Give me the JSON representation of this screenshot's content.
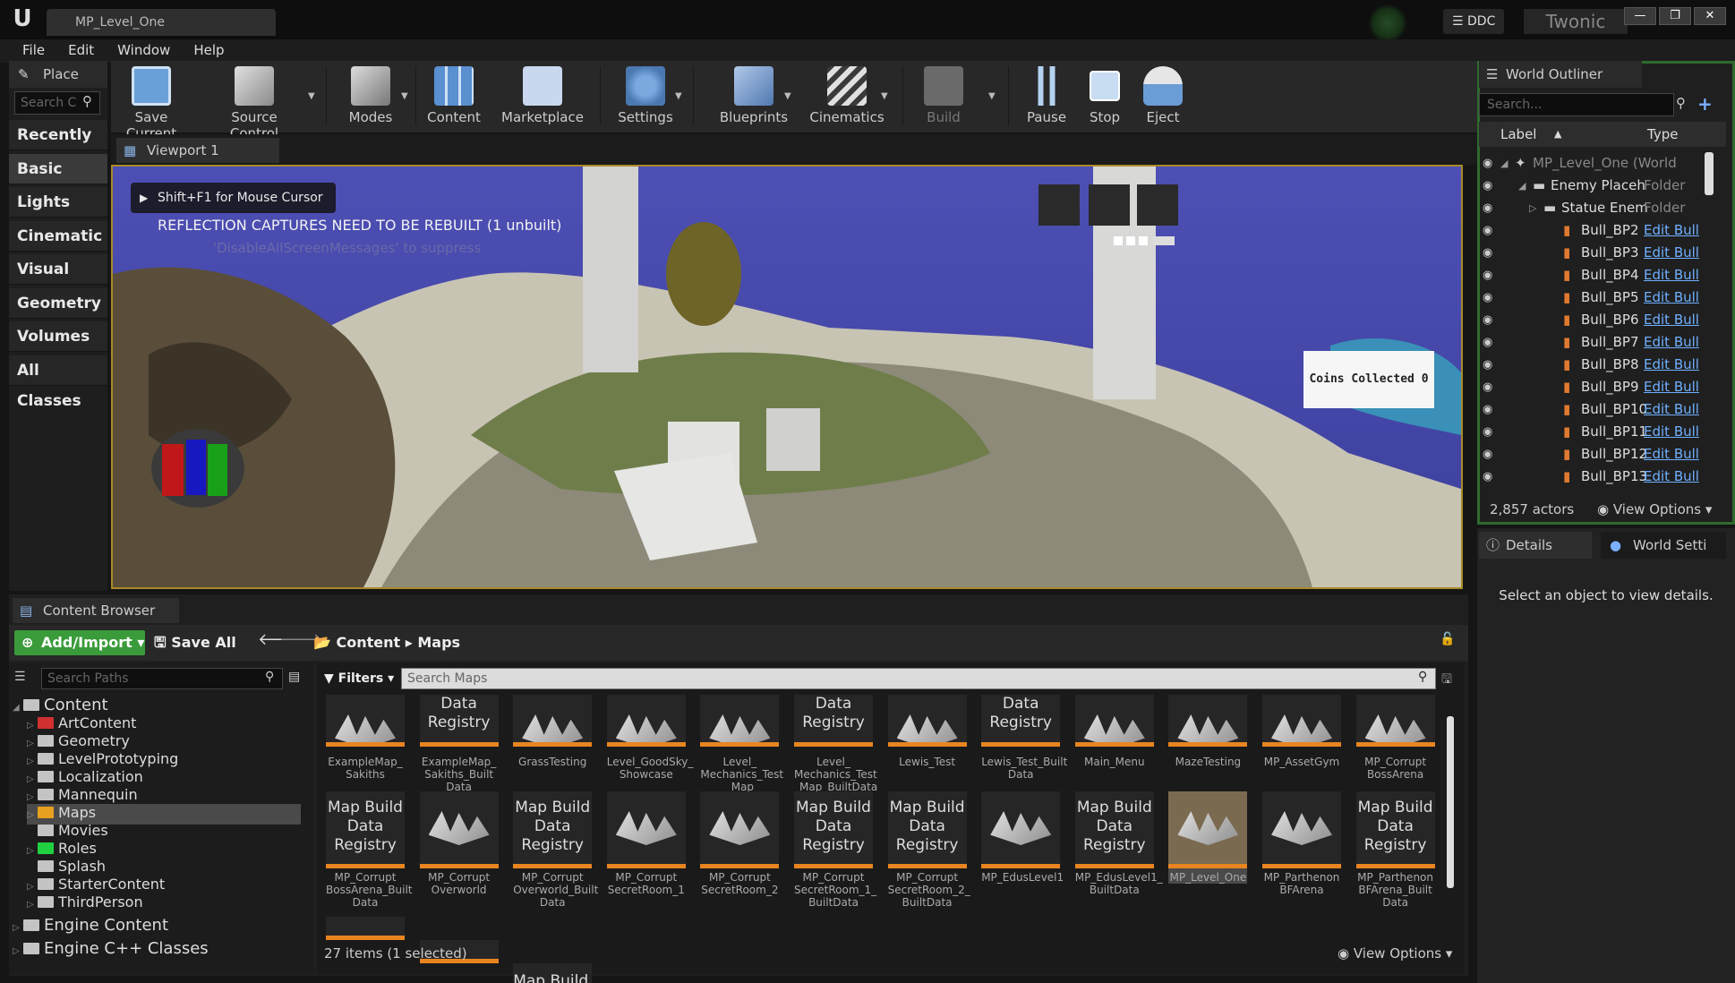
{
  "title_bar": {
    "tab": "MP_Level_One",
    "ddc": "DDC",
    "user": "Twonic"
  },
  "menu": [
    "File",
    "Edit",
    "Window",
    "Help"
  ],
  "place": {
    "tab": "Place",
    "search_placeholder": "Search C",
    "categories": [
      "Recently Pla",
      "Basic",
      "Lights",
      "Cinematic",
      "Visual Effect",
      "Geometry",
      "Volumes",
      "All Classes"
    ],
    "active": "Basic"
  },
  "toolbar": [
    "Save Current",
    "Source Control",
    "Modes",
    "Content",
    "Marketplace",
    "Settings",
    "Blueprints",
    "Cinematics",
    "Build",
    "Pause",
    "Stop",
    "Eject"
  ],
  "viewport": {
    "tab": "Viewport 1",
    "hint": "Shift+F1 for Mouse Cursor",
    "message": "REFLECTION CAPTURES NEED TO BE REBUILT (1 unbuilt)",
    "suppress": "'DisableAllScreenMessages' to suppress",
    "coins": "Coins Collected 0"
  },
  "world_outliner": {
    "tab": "World Outliner",
    "search_placeholder": "Search...",
    "col_label": "Label",
    "col_type": "Type",
    "rows": [
      {
        "label": "MP_Level_One (World",
        "type": "",
        "indent": 0
      },
      {
        "label": "Enemy Placeh",
        "type": "Folder",
        "indent": 1
      },
      {
        "label": "Statue Enem",
        "type": "Folder",
        "indent": 2
      },
      {
        "label": "Bull_BP2",
        "link": "Edit Bull",
        "indent": 3
      },
      {
        "label": "Bull_BP3",
        "link": "Edit Bull",
        "indent": 3
      },
      {
        "label": "Bull_BP4",
        "link": "Edit Bull",
        "indent": 3
      },
      {
        "label": "Bull_BP5",
        "link": "Edit Bull",
        "indent": 3
      },
      {
        "label": "Bull_BP6",
        "link": "Edit Bull",
        "indent": 3
      },
      {
        "label": "Bull_BP7",
        "link": "Edit Bull",
        "indent": 3
      },
      {
        "label": "Bull_BP8",
        "link": "Edit Bull",
        "indent": 3
      },
      {
        "label": "Bull_BP9",
        "link": "Edit Bull",
        "indent": 3
      },
      {
        "label": "Bull_BP10",
        "link": "Edit Bull",
        "indent": 3
      },
      {
        "label": "Bull_BP11",
        "link": "Edit Bull",
        "indent": 3
      },
      {
        "label": "Bull_BP12",
        "link": "Edit Bull",
        "indent": 3
      },
      {
        "label": "Bull_BP13",
        "link": "Edit Bull",
        "indent": 3
      }
    ],
    "actors": "2,857 actors",
    "view_options": "View Options"
  },
  "details": {
    "tab": "Details",
    "world_settings_tab": "World Setti",
    "message": "Select an object to view details."
  },
  "content_browser": {
    "tab": "Content Browser",
    "add_import": "Add/Import",
    "save_all": "Save All",
    "breadcrumb": [
      "Content",
      "Maps"
    ],
    "paths_placeholder": "Search Paths",
    "filters": "Filters",
    "search_placeholder": "Search Maps",
    "tree": [
      {
        "label": "Content",
        "level": 0,
        "big": true
      },
      {
        "label": "ArtContent",
        "level": 1,
        "color": "#d03030"
      },
      {
        "label": "Geometry",
        "level": 1
      },
      {
        "label": "LevelPrototyping",
        "level": 1
      },
      {
        "label": "Localization",
        "level": 1
      },
      {
        "label": "Mannequin",
        "level": 1
      },
      {
        "label": "Maps",
        "level": 1,
        "color": "#e8a020",
        "selected": true
      },
      {
        "label": "Movies",
        "level": 1
      },
      {
        "label": "Roles",
        "level": 1,
        "color": "#20d040"
      },
      {
        "label": "Splash",
        "level": 1
      },
      {
        "label": "StarterContent",
        "level": 1
      },
      {
        "label": "ThirdPerson",
        "level": 1
      },
      {
        "label": "Engine Content",
        "level": 0,
        "big": true
      },
      {
        "label": "Engine C++ Classes",
        "level": 0,
        "big": true
      }
    ],
    "row1": [
      {
        "name": "ExampleMap_\nSakiths",
        "kind": "map"
      },
      {
        "name": "ExampleMap_\nSakiths_Built\nData",
        "kind": "reg",
        "reg": "Data\nRegistry"
      },
      {
        "name": "GrassTesting",
        "kind": "map"
      },
      {
        "name": "Level_GoodSky_\nShowcase",
        "kind": "map"
      },
      {
        "name": "Level_\nMechanics_Test\n_Map",
        "kind": "map"
      },
      {
        "name": "Level_\nMechanics_Test\n_Map_BuiltData",
        "kind": "reg",
        "reg": "Data\nRegistry"
      },
      {
        "name": "Lewis_Test",
        "kind": "map"
      },
      {
        "name": "Lewis_Test_Built\nData",
        "kind": "reg",
        "reg": "Data\nRegistry"
      },
      {
        "name": "Main_Menu",
        "kind": "map"
      },
      {
        "name": "MazeTesting",
        "kind": "map"
      },
      {
        "name": "MP_AssetGym",
        "kind": "map"
      },
      {
        "name": "MP_Corrupt\nBossArena",
        "kind": "map"
      }
    ],
    "row2": [
      {
        "name": "MP_Corrupt\nBossArena_Built\nData",
        "kind": "reg",
        "reg": "Map Build\nData\nRegistry"
      },
      {
        "name": "MP_Corrupt\nOverworld",
        "kind": "map"
      },
      {
        "name": "MP_Corrupt\nOverworld_Built\nData",
        "kind": "reg",
        "reg": "Map Build\nData\nRegistry"
      },
      {
        "name": "MP_Corrupt\nSecretRoom_1",
        "kind": "map"
      },
      {
        "name": "MP_Corrupt\nSecretRoom_2",
        "kind": "map"
      },
      {
        "name": "MP_Corrupt\nSecretRoom_1_\nBuiltData",
        "kind": "reg",
        "reg": "Map Build\nData\nRegistry"
      },
      {
        "name": "MP_Corrupt\nSecretRoom_2_\nBuiltData",
        "kind": "reg",
        "reg": "Map Build\nData\nRegistry"
      },
      {
        "name": "MP_EdusLevel1",
        "kind": "map"
      },
      {
        "name": "MP_EdusLevel1_\nBuiltData",
        "kind": "reg",
        "reg": "Map Build\nData\nRegistry"
      },
      {
        "name": "MP_Level_One",
        "kind": "map",
        "selected": true
      },
      {
        "name": "MP_Parthenon\nBFArena",
        "kind": "map"
      },
      {
        "name": "MP_Parthenon\nBFArena_Built\nData",
        "kind": "reg",
        "reg": "Map Build\nData\nRegistry"
      }
    ],
    "row3_partial": "Map Build",
    "status": "27 items (1 selected)",
    "view_options": "View Options"
  }
}
